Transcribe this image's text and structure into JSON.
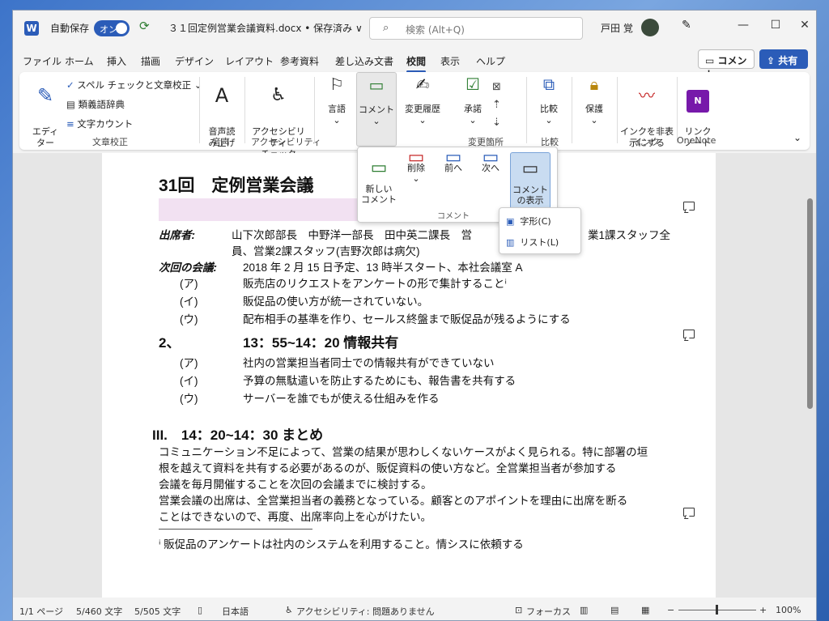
{
  "titlebar": {
    "autosave_label": "自動保存",
    "autosave_state": "オン",
    "doc_title": "３１回定例営業会議資料.docx • 保存済み ∨",
    "search_placeholder": "検索 (Alt+Q)",
    "user_name": "戸田 覚"
  },
  "menu": {
    "items": [
      "ファイル",
      "ホーム",
      "挿入",
      "描画",
      "デザイン",
      "レイアウト",
      "参考資料",
      "差し込み文書",
      "校閲",
      "表示",
      "ヘルプ"
    ],
    "active": "校閲",
    "comment_btn": "コメント",
    "share_btn": "共有"
  },
  "ribbon": {
    "editor": "エディ\nター",
    "spell": "スペル チェックと文章校正",
    "thesaurus": "類義語辞典",
    "wordcount": "文字カウント",
    "grp_proofing": "文章校正",
    "readaloud": "音声読\nみ上げ",
    "grp_speech": "音声",
    "accessibility": "アクセシビリティ\nチェック",
    "grp_access": "アクセシビリティ",
    "language": "言語",
    "comment": "コメント",
    "track": "変更履歴",
    "accept": "承諾",
    "grp_changes": "変更箇所",
    "compare": "比較",
    "grp_compare": "比較",
    "protect": "保護",
    "ink": "インクを非表\n示にする",
    "grp_ink": "インク",
    "link": "リンク\nノート",
    "grp_onenote": "OneNote"
  },
  "dropdown": {
    "new": "新しい\nコメント",
    "delete": "削除",
    "prev": "前へ",
    "next": "次へ",
    "show": "コメント\nの表示",
    "group": "コメント"
  },
  "submenu": {
    "contextual": "字形(C)",
    "list": "リスト(L)"
  },
  "doc": {
    "title": "31回　定例営業会議",
    "attendees_label": "出席者:",
    "attendees_1": "山下次郎部長　中野洋一部長　田中英二課長　営",
    "attendees_1b": "業1課スタッフ全",
    "attendees_2": "員、営業2課スタッフ(吉野次郎は病欠)",
    "next_label": "次回の会議:",
    "next_text": "2018 年 2 月 15 日予定、13 時半スタート、本社会議室 A",
    "a1_mark": "(ア)",
    "a1": "販売店のリクエストをアンケートの形で集計することⁱ",
    "a2_mark": "(イ)",
    "a2": "販促品の使い方が統一されていない。",
    "a3_mark": "(ウ)",
    "a3": "配布相手の基準を作り、セールス終盤まで販促品が残るようにする",
    "sec2_num": "2、",
    "sec2_title": "13：55~14：20 情報共有",
    "b1_mark": "(ア)",
    "b1": "社内の営業担当者同士での情報共有ができていない",
    "b2_mark": "(イ)",
    "b2": "予算の無駄遣いを防止するためにも、報告書を共有する",
    "b3_mark": "(ウ)",
    "b3": "サーバーを誰でもが使える仕組みを作る",
    "sec3": "III.　14：20~14：30 まとめ",
    "p1_1": "コミュニケーション不足によって、営業の結果が思わしくないケースがよく見られる。特に部署の垣",
    "p1_2": "根を越えて資料を共有する必要があるのが、販促資料の使い方など。全営業担当者が参加する",
    "p1_3": "会議を毎月開催することを次回の会議までに検討する。",
    "p2_1": "営業会議の出席は、全営業担当者の義務となっている。顧客とのアポイントを理由に出席を断る",
    "p2_2": "ことはできないので、再度、出席率向上を心がけたい。",
    "footnote": "ⁱ 販促品のアンケートは社内のシステムを利用すること。情シスに依頼する"
  },
  "status": {
    "page": "1/1 ページ",
    "words1": "5/460 文字",
    "words2": "5/505 文字",
    "lang": "日本語",
    "access": "アクセシビリティ: 問題ありません",
    "focus": "フォーカス",
    "zoom": "100%"
  },
  "colors": {
    "accent": "#2b5cb8",
    "highlight": "#f2e1f2"
  }
}
